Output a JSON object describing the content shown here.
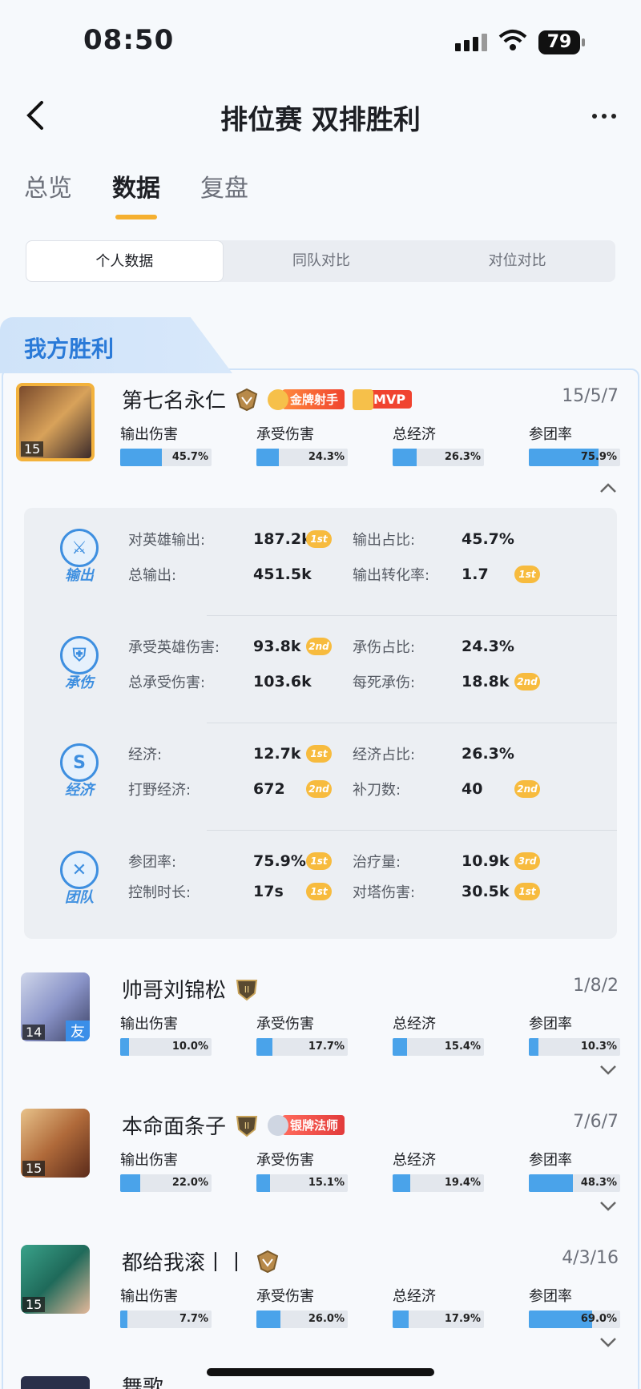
{
  "status": {
    "time": "08:50",
    "battery": "79"
  },
  "header": {
    "title": "排位赛 双排胜利"
  },
  "tabs": [
    {
      "label": "总览"
    },
    {
      "label": "数据"
    },
    {
      "label": "复盘"
    }
  ],
  "segment": [
    {
      "label": "个人数据"
    },
    {
      "label": "同队对比"
    },
    {
      "label": "对位对比"
    }
  ],
  "banner": "我方胜利",
  "stat_labels": [
    "输出伤害",
    "承受伤害",
    "总经济",
    "参团率"
  ],
  "players": [
    {
      "name": "第七名永仁",
      "level": "15",
      "kda": "15/5/7",
      "badge": "金牌射手",
      "mvp": "MVP",
      "bars": [
        "45.7%",
        "24.3%",
        "26.3%",
        "75.9%"
      ],
      "fills": [
        45.7,
        24.3,
        26.3,
        75.9
      ]
    },
    {
      "name": "帅哥刘锦松",
      "level": "14",
      "friend": "友",
      "kda": "1/8/2",
      "bars": [
        "10.0%",
        "17.7%",
        "15.4%",
        "10.3%"
      ],
      "fills": [
        10.0,
        17.7,
        15.4,
        10.3
      ]
    },
    {
      "name": "本命面条子",
      "level": "15",
      "kda": "7/6/7",
      "badge": "银牌法师",
      "bars": [
        "22.0%",
        "15.1%",
        "19.4%",
        "48.3%"
      ],
      "fills": [
        22.0,
        15.1,
        19.4,
        48.3
      ]
    },
    {
      "name": "都给我滚丨丨",
      "level": "15",
      "kda": "4/3/16",
      "bars": [
        "7.7%",
        "26.0%",
        "17.9%",
        "69.0%"
      ],
      "fills": [
        7.7,
        26.0,
        17.9,
        69.0
      ]
    }
  ],
  "detail": [
    {
      "label": "输出",
      "rows": [
        [
          {
            "k": "对英雄输出:",
            "v": "187.2k",
            "r": "1st"
          },
          {
            "k": "输出占比:",
            "v": "45.7%"
          }
        ],
        [
          {
            "k": "总输出:",
            "v": "451.5k"
          },
          {
            "k": "输出转化率:",
            "v": "1.7",
            "r": "1st"
          }
        ]
      ]
    },
    {
      "label": "承伤",
      "rows": [
        [
          {
            "k": "承受英雄伤害:",
            "v": "93.8k",
            "r": "2nd"
          },
          {
            "k": "承伤占比:",
            "v": "24.3%"
          }
        ],
        [
          {
            "k": "总承受伤害:",
            "v": "103.6k"
          },
          {
            "k": "每死承伤:",
            "v": "18.8k",
            "r": "2nd"
          }
        ]
      ]
    },
    {
      "label": "经济",
      "icon_text": "S",
      "rows": [
        [
          {
            "k": "经济:",
            "v": "12.7k",
            "r": "1st"
          },
          {
            "k": "经济占比:",
            "v": "26.3%"
          }
        ],
        [
          {
            "k": "打野经济:",
            "v": "672",
            "r": "2nd"
          },
          {
            "k": "补刀数:",
            "v": "40",
            "r": "2nd"
          }
        ]
      ]
    },
    {
      "label": "团队",
      "rows": [
        [
          {
            "k": "参团率:",
            "v": "75.9%",
            "r": "1st"
          },
          {
            "k": "治疗量:",
            "v": "10.9k",
            "r": "3rd"
          }
        ],
        [
          {
            "k": "控制时长:",
            "v": "17s",
            "r": "1st"
          },
          {
            "k": "对塔伤害:",
            "v": "30.5k",
            "r": "1st"
          }
        ]
      ]
    }
  ],
  "partial_name": "舞歌",
  "colors": {
    "accent": "#4aa3ea",
    "tab_underline": "#f5b030",
    "rank_badge": "#f7bb3e",
    "mvp": "#f0432f"
  }
}
